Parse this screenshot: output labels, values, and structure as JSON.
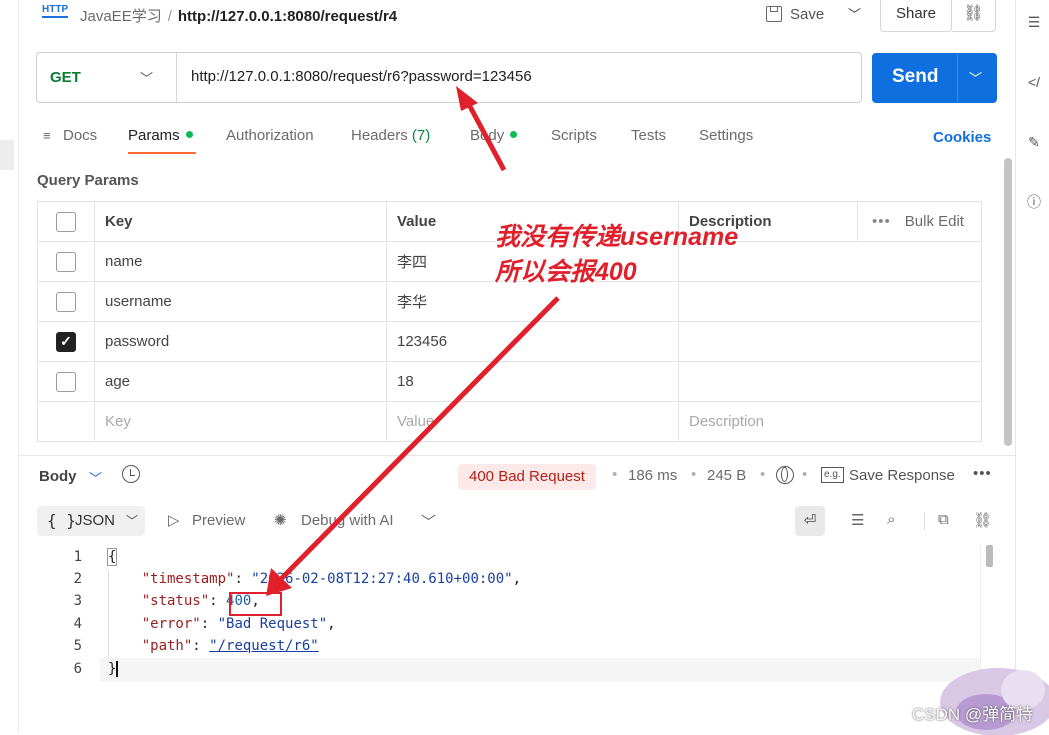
{
  "header": {
    "protocol_icon_label": "HTTP",
    "collection": "JavaEE学习",
    "separator": "/",
    "request_name": "http://127.0.0.1:8080/request/r4",
    "save_label": "Save",
    "share_label": "Share"
  },
  "request": {
    "method": "GET",
    "url": "http://127.0.0.1:8080/request/r6?password=123456",
    "send_label": "Send"
  },
  "tabs": {
    "docs": "Docs",
    "params": "Params",
    "authorization": "Authorization",
    "headers": "Headers",
    "headers_count": "(7)",
    "body": "Body",
    "scripts": "Scripts",
    "tests": "Tests",
    "settings": "Settings",
    "cookies": "Cookies"
  },
  "query_params": {
    "title": "Query Params",
    "columns": {
      "key": "Key",
      "value": "Value",
      "description": "Description"
    },
    "bulk_edit": "Bulk Edit",
    "rows": [
      {
        "key": "name",
        "value": "李四",
        "description": "",
        "checked": false
      },
      {
        "key": "username",
        "value": "李华",
        "description": "",
        "checked": false
      },
      {
        "key": "password",
        "value": "123456",
        "description": "",
        "checked": true
      },
      {
        "key": "age",
        "value": "18",
        "description": "",
        "checked": false
      }
    ],
    "placeholders": {
      "key": "Key",
      "value": "Value",
      "description": "Description"
    }
  },
  "response": {
    "body_label": "Body",
    "status": "400 Bad Request",
    "time": "186 ms",
    "size": "245 B",
    "save_response": "Save Response",
    "format": "JSON",
    "format_icon": "{ }",
    "preview": "Preview",
    "debug_ai": "Debug with AI",
    "line_numbers": [
      "1",
      "2",
      "3",
      "4",
      "5",
      "6"
    ],
    "lines": {
      "l1": "{",
      "timestamp_key": "\"timestamp\"",
      "timestamp_val": "\"2026-02-08T12:27:40.610+00:00\"",
      "status_key": "\"status\"",
      "status_val": "400",
      "error_key": "\"error\"",
      "error_val": "\"Bad Request\"",
      "path_key": "\"path\"",
      "path_val": "\"/request/r6\"",
      "l6": "}"
    }
  },
  "annotation": {
    "line1": "我没有传递username",
    "line2": "所以会报400"
  },
  "watermark": "CSDN @弹简特",
  "colors": {
    "send": "#0f6fde",
    "active_tab_underline": "#ff6c37",
    "method_get": "#0a7d33",
    "status_error": "#b4201a",
    "annotation": "#e0202a"
  }
}
